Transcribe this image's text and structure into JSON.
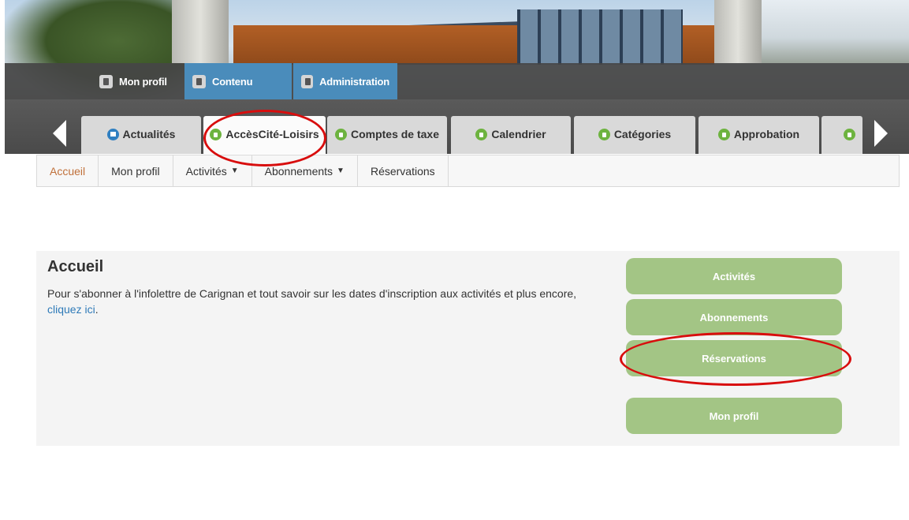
{
  "admin_bar": {
    "items": [
      {
        "label": "Mon profil",
        "icon": "person-icon"
      },
      {
        "label": "Contenu",
        "icon": "document-icon"
      },
      {
        "label": "Administration",
        "icon": "settings-icon"
      }
    ]
  },
  "tabs": [
    {
      "label": "Actualités",
      "icon": "home-icon"
    },
    {
      "label": "AccèsCité-Loisirs",
      "icon": "leaf-icon"
    },
    {
      "label": "Comptes de taxe",
      "icon": "leaf-icon"
    },
    {
      "label": "Calendrier",
      "icon": "leaf-icon"
    },
    {
      "label": "Catégories",
      "icon": "leaf-icon"
    },
    {
      "label": "Approbation",
      "icon": "leaf-icon"
    }
  ],
  "subnav": {
    "items": [
      "Accueil",
      "Mon profil",
      "Activités",
      "Abonnements",
      "Réservations"
    ],
    "caret": "▼"
  },
  "page": {
    "title": "Accueil",
    "intro_text": "Pour s'abonner à l'infolettre de Carignan et tout savoir sur les dates d'inscription aux activités et plus encore,",
    "intro_link": "cliquez ici",
    "intro_end": "."
  },
  "sidebar_buttons": [
    "Activités",
    "Abonnements",
    "Réservations",
    "Mon profil"
  ],
  "colors": {
    "admin_active": "#4a8cbb",
    "button_green": "#a3c585",
    "link_blue": "#2e7ab8",
    "active_nav": "#c0703a",
    "annotation_red": "#d80d0d"
  }
}
